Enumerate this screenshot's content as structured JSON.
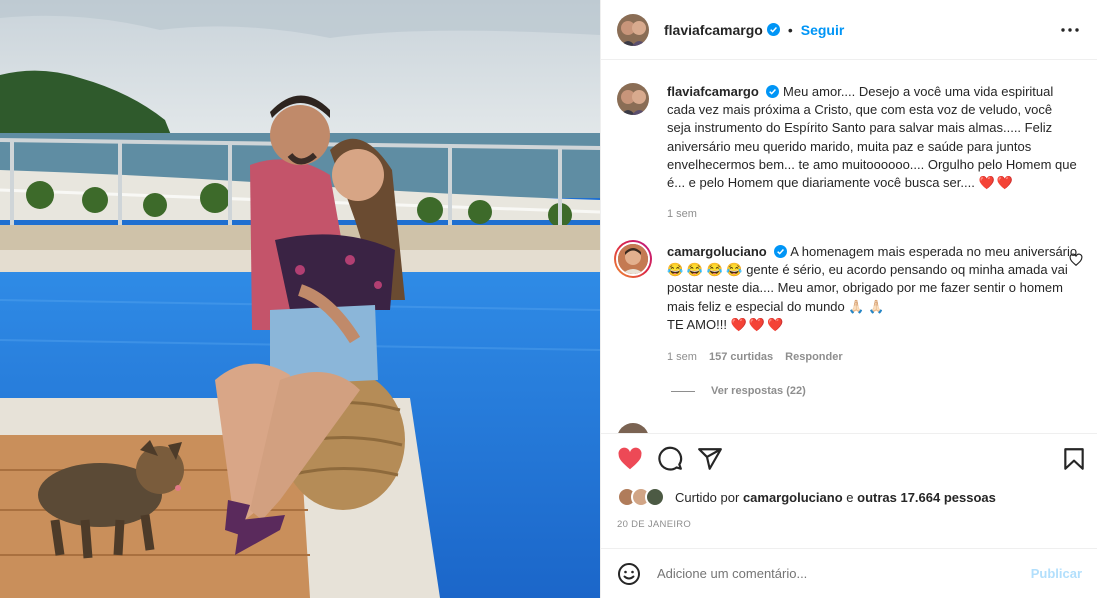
{
  "post": {
    "author": "flaviafcamargo",
    "dot": "•",
    "follow_label": "Seguir",
    "caption": "Meu amor.... Desejo a você uma vida espiritual cada vez mais próxima a Cristo, que com esta voz de veludo, você seja instrumento do Espírito Santo para salvar mais almas..... Feliz aniversário meu querido marido, muita paz e saúde para juntos envelhecermos bem... te amo muitoooooo.... Orgulho pelo Homem que é... e pelo Homem que diariamente você busca ser....",
    "caption_hearts": "❤️❤️",
    "caption_time": "1 sem"
  },
  "comments": [
    {
      "user": "camargoluciano",
      "text": "A homenagem mais esperada no meu aniversário😂 😂 😂 😂  gente é sério, eu acordo pensando oq minha amada vai postar neste dia.... Meu amor, obrigado por me fazer sentir o homem mais feliz e especial do mundo 🙏🏻 🙏🏻",
      "text_end": "TE AMO!!!",
      "hearts": "❤️❤️❤️",
      "time": "1 sem",
      "likes": "157 curtidas",
      "reply": "Responder",
      "view_replies": "Ver respostas (22)"
    }
  ],
  "likes": {
    "prefix": "Curtido por",
    "user": "camargoluciano",
    "mid": "e",
    "others": "outras 17.664 pessoas"
  },
  "date": "20 DE JANEIRO",
  "add_comment": {
    "placeholder": "Adicione um comentário...",
    "post_label": "Publicar"
  },
  "colors": {
    "accent": "#0095f6",
    "like": "#ed4956",
    "muted": "#8e8e8e"
  },
  "icons": [
    "verified-icon",
    "more-options-icon",
    "heart-icon",
    "comment-icon",
    "share-icon",
    "save-icon",
    "emoji-icon"
  ]
}
